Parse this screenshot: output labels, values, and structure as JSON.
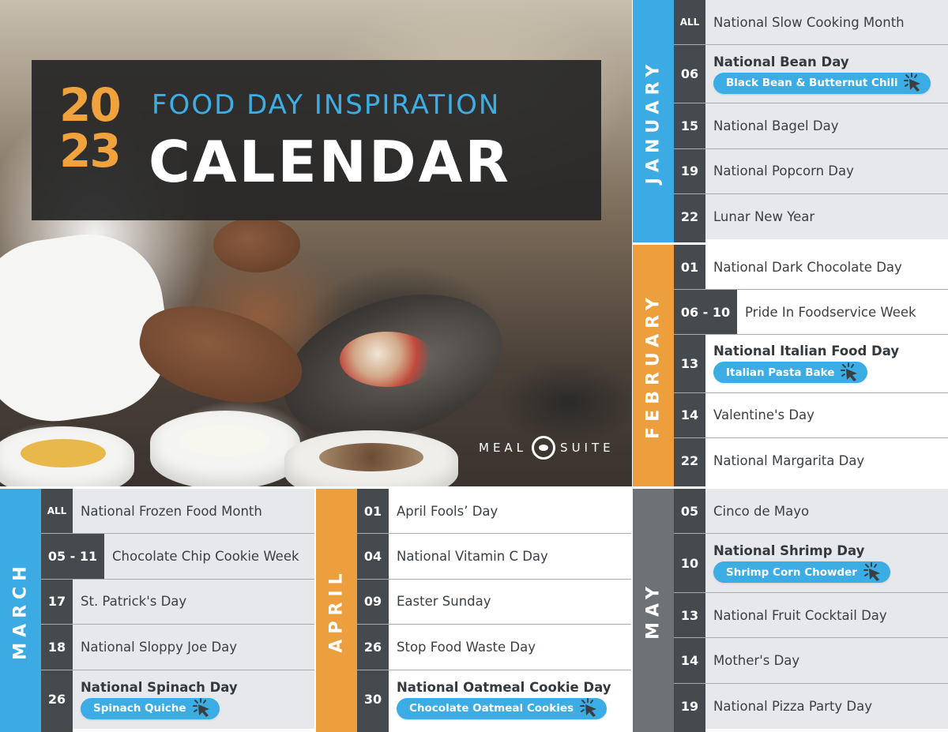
{
  "header": {
    "year_top": "20",
    "year_bottom": "23",
    "subtitle": "FOOD DAY INSPIRATION",
    "title": "CALENDAR"
  },
  "brand": {
    "left_word": "MEAL",
    "right_word": "SUITE",
    "logo_icon": "meal-suite-logo-icon"
  },
  "colors": {
    "blue": "#3cabe3",
    "orange": "#ee9f3d",
    "grey": "#6c7276",
    "dark": "#454a4e",
    "row_grey": "#e6e8ec"
  },
  "months": {
    "january": {
      "label": "JANUARY",
      "rows": [
        {
          "date": "ALL",
          "event": "National Slow Cooking Month"
        },
        {
          "date": "06",
          "event": "National Bean Day",
          "recipe": "Black Bean & Butternut Chili"
        },
        {
          "date": "15",
          "event": "National Bagel Day"
        },
        {
          "date": "19",
          "event": "National Popcorn Day"
        },
        {
          "date": "22",
          "event": "Lunar New Year"
        }
      ]
    },
    "february": {
      "label": "FEBRUARY",
      "rows": [
        {
          "date": "01",
          "event": "National Dark Chocolate Day"
        },
        {
          "date": "06 - 10",
          "event": "Pride In Foodservice Week"
        },
        {
          "date": "13",
          "event": "National Italian Food Day",
          "recipe": "Italian Pasta Bake"
        },
        {
          "date": "14",
          "event": "Valentine's Day"
        },
        {
          "date": "22",
          "event": "National Margarita Day"
        }
      ]
    },
    "march": {
      "label": "MARCH",
      "rows": [
        {
          "date": "ALL",
          "event": "National Frozen Food Month"
        },
        {
          "date": "05 - 11",
          "event": "Chocolate Chip Cookie Week"
        },
        {
          "date": "17",
          "event": "St. Patrick's Day"
        },
        {
          "date": "18",
          "event": "National Sloppy Joe Day"
        },
        {
          "date": "26",
          "event": "National Spinach Day",
          "recipe": "Spinach Quiche"
        }
      ]
    },
    "april": {
      "label": "APRIL",
      "rows": [
        {
          "date": "01",
          "event": "April Fools’ Day"
        },
        {
          "date": "04",
          "event": "National Vitamin C Day"
        },
        {
          "date": "09",
          "event": "Easter Sunday"
        },
        {
          "date": "26",
          "event": "Stop Food Waste Day"
        },
        {
          "date": "30",
          "event": "National Oatmeal Cookie Day",
          "recipe": "Chocolate Oatmeal Cookies"
        }
      ]
    },
    "may": {
      "label": "MAY",
      "rows": [
        {
          "date": "05",
          "event": "Cinco de Mayo"
        },
        {
          "date": "10",
          "event": "National Shrimp Day",
          "recipe": "Shrimp Corn Chowder"
        },
        {
          "date": "13",
          "event": "National Fruit Cocktail Day"
        },
        {
          "date": "14",
          "event": "Mother's Day"
        },
        {
          "date": "19",
          "event": "National Pizza Party Day"
        }
      ]
    }
  }
}
